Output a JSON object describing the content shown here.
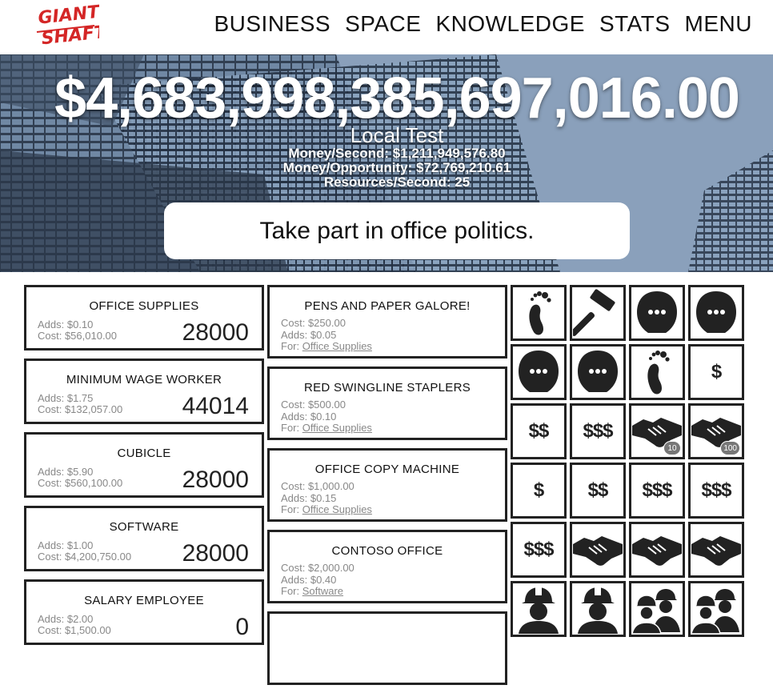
{
  "logo": {
    "line1": "GIANT",
    "line2": "SHAFT"
  },
  "nav": [
    "BUSINESS",
    "SPACE",
    "KNOWLEDGE",
    "STATS",
    "MENU"
  ],
  "hero": {
    "money": "$4,683,998,385,697,016.00",
    "company": "Local Test",
    "money_per_second": "Money/Second: $1,211,949,576.80",
    "money_per_opportunity": "Money/Opportunity: $72,769,210.61",
    "resources_per_second": "Resources/Second: 25",
    "action": "Take part in office politics."
  },
  "resources": [
    {
      "title": "OFFICE SUPPLIES",
      "adds": "Adds: $0.10",
      "cost": "Cost: $56,010.00",
      "count": "28000"
    },
    {
      "title": "MINIMUM WAGE WORKER",
      "adds": "Adds: $1.75",
      "cost": "Cost: $132,057.00",
      "count": "44014"
    },
    {
      "title": "CUBICLE",
      "adds": "Adds: $5.90",
      "cost": "Cost: $560,100.00",
      "count": "28000"
    },
    {
      "title": "SOFTWARE",
      "adds": "Adds: $1.00",
      "cost": "Cost: $4,200,750.00",
      "count": "28000"
    },
    {
      "title": "SALARY EMPLOYEE",
      "adds": "Adds: $2.00",
      "cost": "Cost: $1,500.00",
      "count": "0"
    }
  ],
  "upgrades": [
    {
      "title": "PENS AND PAPER GALORE!",
      "cost": "Cost: $250.00",
      "adds": "Adds: $0.05",
      "for_label": "For: ",
      "for": "Office Supplies"
    },
    {
      "title": "RED SWINGLINE STAPLERS",
      "cost": "Cost: $500.00",
      "adds": "Adds: $0.10",
      "for_label": "For: ",
      "for": "Office Supplies"
    },
    {
      "title": "OFFICE COPY MACHINE",
      "cost": "Cost: $1,000.00",
      "adds": "Adds: $0.15",
      "for_label": "For: ",
      "for": "Office Supplies"
    },
    {
      "title": "CONTOSO OFFICE",
      "cost": "Cost: $2,000.00",
      "adds": "Adds: $0.40",
      "for_label": "For: ",
      "for": "Software"
    }
  ],
  "achievements": [
    {
      "icon": "footprint-icon"
    },
    {
      "icon": "hammer-icon"
    },
    {
      "icon": "head-speech-icon"
    },
    {
      "icon": "head-speech-icon"
    },
    {
      "icon": "head-speech-icon"
    },
    {
      "icon": "head-speech-icon"
    },
    {
      "icon": "footprint-icon"
    },
    {
      "icon": "dollar-icon",
      "text": "$"
    },
    {
      "icon": "dollar-icon",
      "text": "$$"
    },
    {
      "icon": "dollar-icon",
      "text": "$$$"
    },
    {
      "icon": "handshake-icon",
      "badge": "10"
    },
    {
      "icon": "handshake-icon",
      "badge": "100"
    },
    {
      "icon": "dollar-icon",
      "text": "$"
    },
    {
      "icon": "dollar-icon",
      "text": "$$"
    },
    {
      "icon": "dollar-icon",
      "text": "$$$"
    },
    {
      "icon": "dollar-icon",
      "text": "$$$"
    },
    {
      "icon": "dollar-icon",
      "text": "$$$"
    },
    {
      "icon": "handshake-icon"
    },
    {
      "icon": "handshake-icon"
    },
    {
      "icon": "handshake-icon"
    },
    {
      "icon": "worker-icon"
    },
    {
      "icon": "worker-icon"
    },
    {
      "icon": "workers-group-icon"
    },
    {
      "icon": "workers-group-icon"
    }
  ],
  "colors": {
    "logo": "#d42626",
    "border": "#222222",
    "meta": "#888888"
  }
}
